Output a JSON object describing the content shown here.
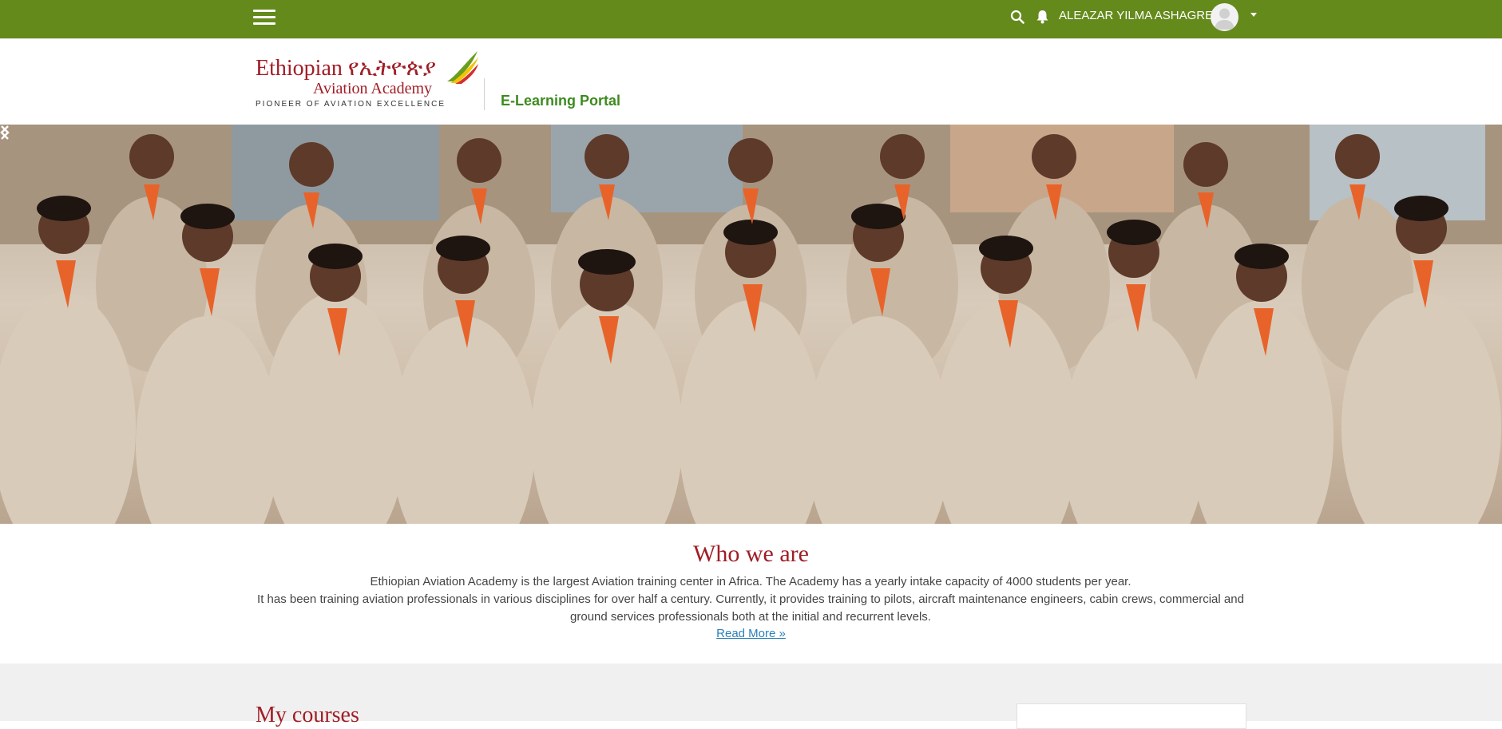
{
  "topbar": {
    "menu_icon": "hamburger-menu-icon",
    "search_icon": "search-icon",
    "notification_icon": "bell-icon",
    "user_name": "ALEAZAR YILMA ASHAGREA",
    "avatar_icon": "user-avatar-icon",
    "dropdown_icon": "caret-down-icon",
    "bg_color": "#648a1c"
  },
  "header": {
    "logo": {
      "line1": "Ethiopian የኢትዮጵያ",
      "line2": "Aviation Academy",
      "tagline": "PIONEER OF AVIATION EXCELLENCE"
    },
    "portal_title": "E-Learning Portal"
  },
  "hero": {
    "prev_icon": "chevron-left-icon",
    "next_icon": "chevron-right-icon"
  },
  "about": {
    "title": "Who we are",
    "paragraph1": "Ethiopian Aviation Academy is the largest Aviation training center in Africa. The Academy has a yearly intake capacity of 4000 students per year.",
    "paragraph2": "It has been training aviation professionals in various disciplines for over half a century. Currently, it provides training to pilots, aircraft maintenance engineers, cabin crews, commercial and ground services professionals both at the initial and recurrent levels.",
    "read_more": "Read More »"
  },
  "courses": {
    "title": "My courses"
  },
  "colors": {
    "accent_red": "#a01d26",
    "portal_green": "#3d8b1f",
    "link_blue": "#2a7fb8"
  }
}
